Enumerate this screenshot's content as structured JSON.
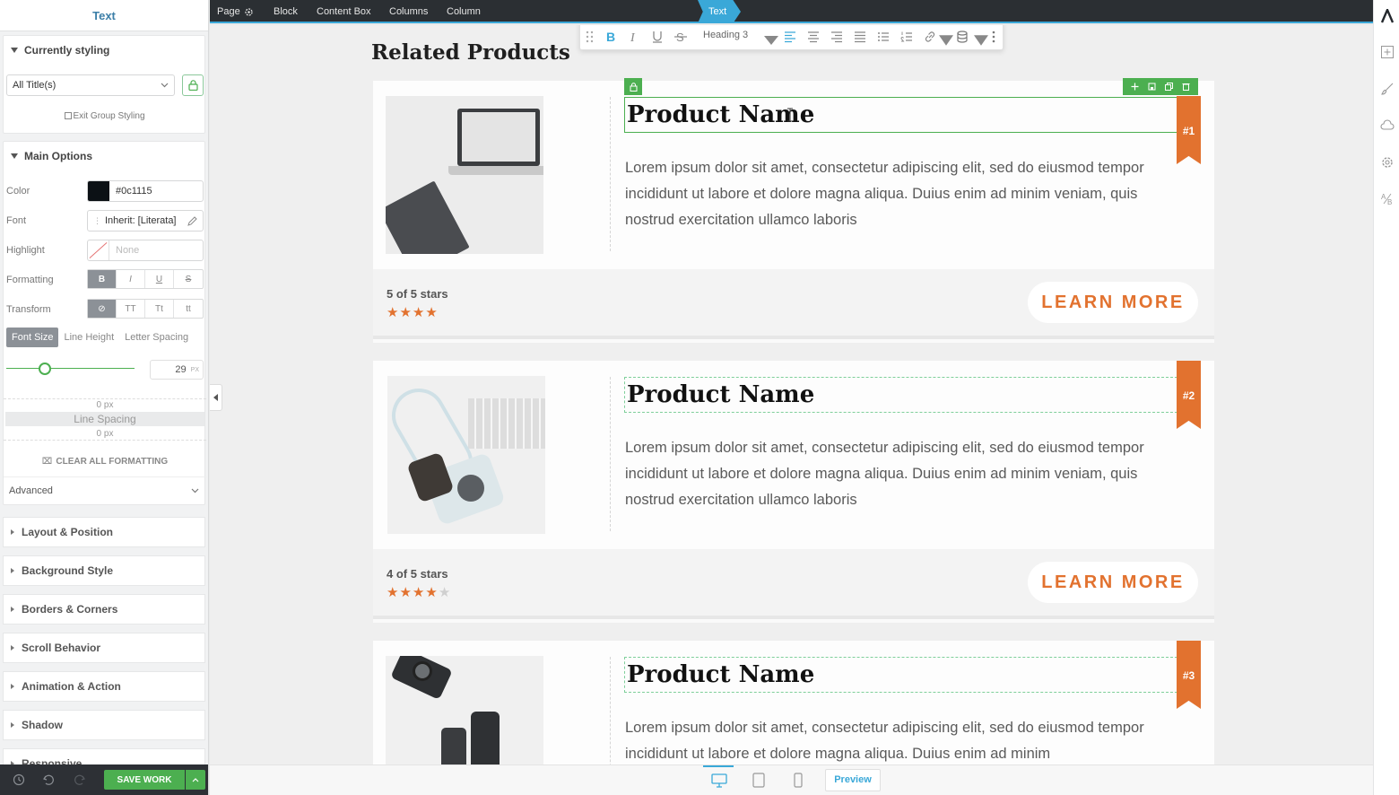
{
  "sidebar": {
    "title": "Text",
    "currently_styling": {
      "heading": "Currently styling",
      "select_value": "All Title(s)",
      "exit_label": "Exit Group Styling"
    },
    "main_options": {
      "heading": "Main Options",
      "color_label": "Color",
      "color_value": "#0c1115",
      "color_swatch": "#0c1115",
      "font_label": "Font",
      "font_value": "Inherit: [Literata]",
      "highlight_label": "Highlight",
      "highlight_value": "None",
      "formatting_label": "Formatting",
      "formatting_buttons": [
        "B",
        "I",
        "U",
        "S"
      ],
      "transform_label": "Transform",
      "transform_buttons": [
        "⊘",
        "TT",
        "Tt",
        "tt"
      ],
      "size_tabs": [
        "Font Size",
        "Line Height",
        "Letter Spacing"
      ],
      "font_size_value": "29",
      "font_size_unit": "PX",
      "spacing_top": "0 px",
      "line_spacing_label": "Line Spacing",
      "spacing_bottom": "0 px",
      "clear_label": "CLEAR ALL FORMATTING",
      "advanced_label": "Advanced"
    },
    "sections": [
      "Layout & Position",
      "Background Style",
      "Borders & Corners",
      "Scroll Behavior",
      "Animation & Action",
      "Shadow",
      "Responsive"
    ],
    "save_label": "SAVE WORK"
  },
  "breadcrumb": {
    "items": [
      "Page",
      "Block",
      "Content Box",
      "Columns",
      "Column"
    ],
    "active": "Text"
  },
  "toolbar": {
    "heading_select": "Heading 3"
  },
  "content": {
    "section_title": "Related Products",
    "products": [
      {
        "title": "Product Name",
        "description": "Lorem ipsum dolor sit amet, consectetur adipiscing elit, sed do eiusmod tempor incididunt ut labore et dolore magna aliqua. Duius enim ad minim veniam, quis nostrud exercitation ullamco laboris",
        "rank": "#1",
        "rating_text": "5 of 5 stars",
        "rating": 4,
        "button": "LEARN MORE"
      },
      {
        "title": "Product Name",
        "description": "Lorem ipsum dolor sit amet, consectetur adipiscing elit, sed do eiusmod tempor incididunt ut labore et dolore magna aliqua. Duius enim ad minim veniam, quis nostrud exercitation ullamco laboris",
        "rank": "#2",
        "rating_text": "4 of 5 stars",
        "rating": 4,
        "button": "LEARN MORE"
      },
      {
        "title": "Product Name",
        "description": "Lorem ipsum dolor sit amet, consectetur adipiscing elit, sed do eiusmod tempor incididunt ut labore et dolore magna aliqua. Duius enim ad minim",
        "rank": "#3"
      }
    ]
  },
  "devicebar": {
    "preview_label": "Preview"
  },
  "colors": {
    "accent_orange": "#e2722f",
    "accent_blue": "#3aa8d8",
    "accent_green": "#4caf50"
  }
}
